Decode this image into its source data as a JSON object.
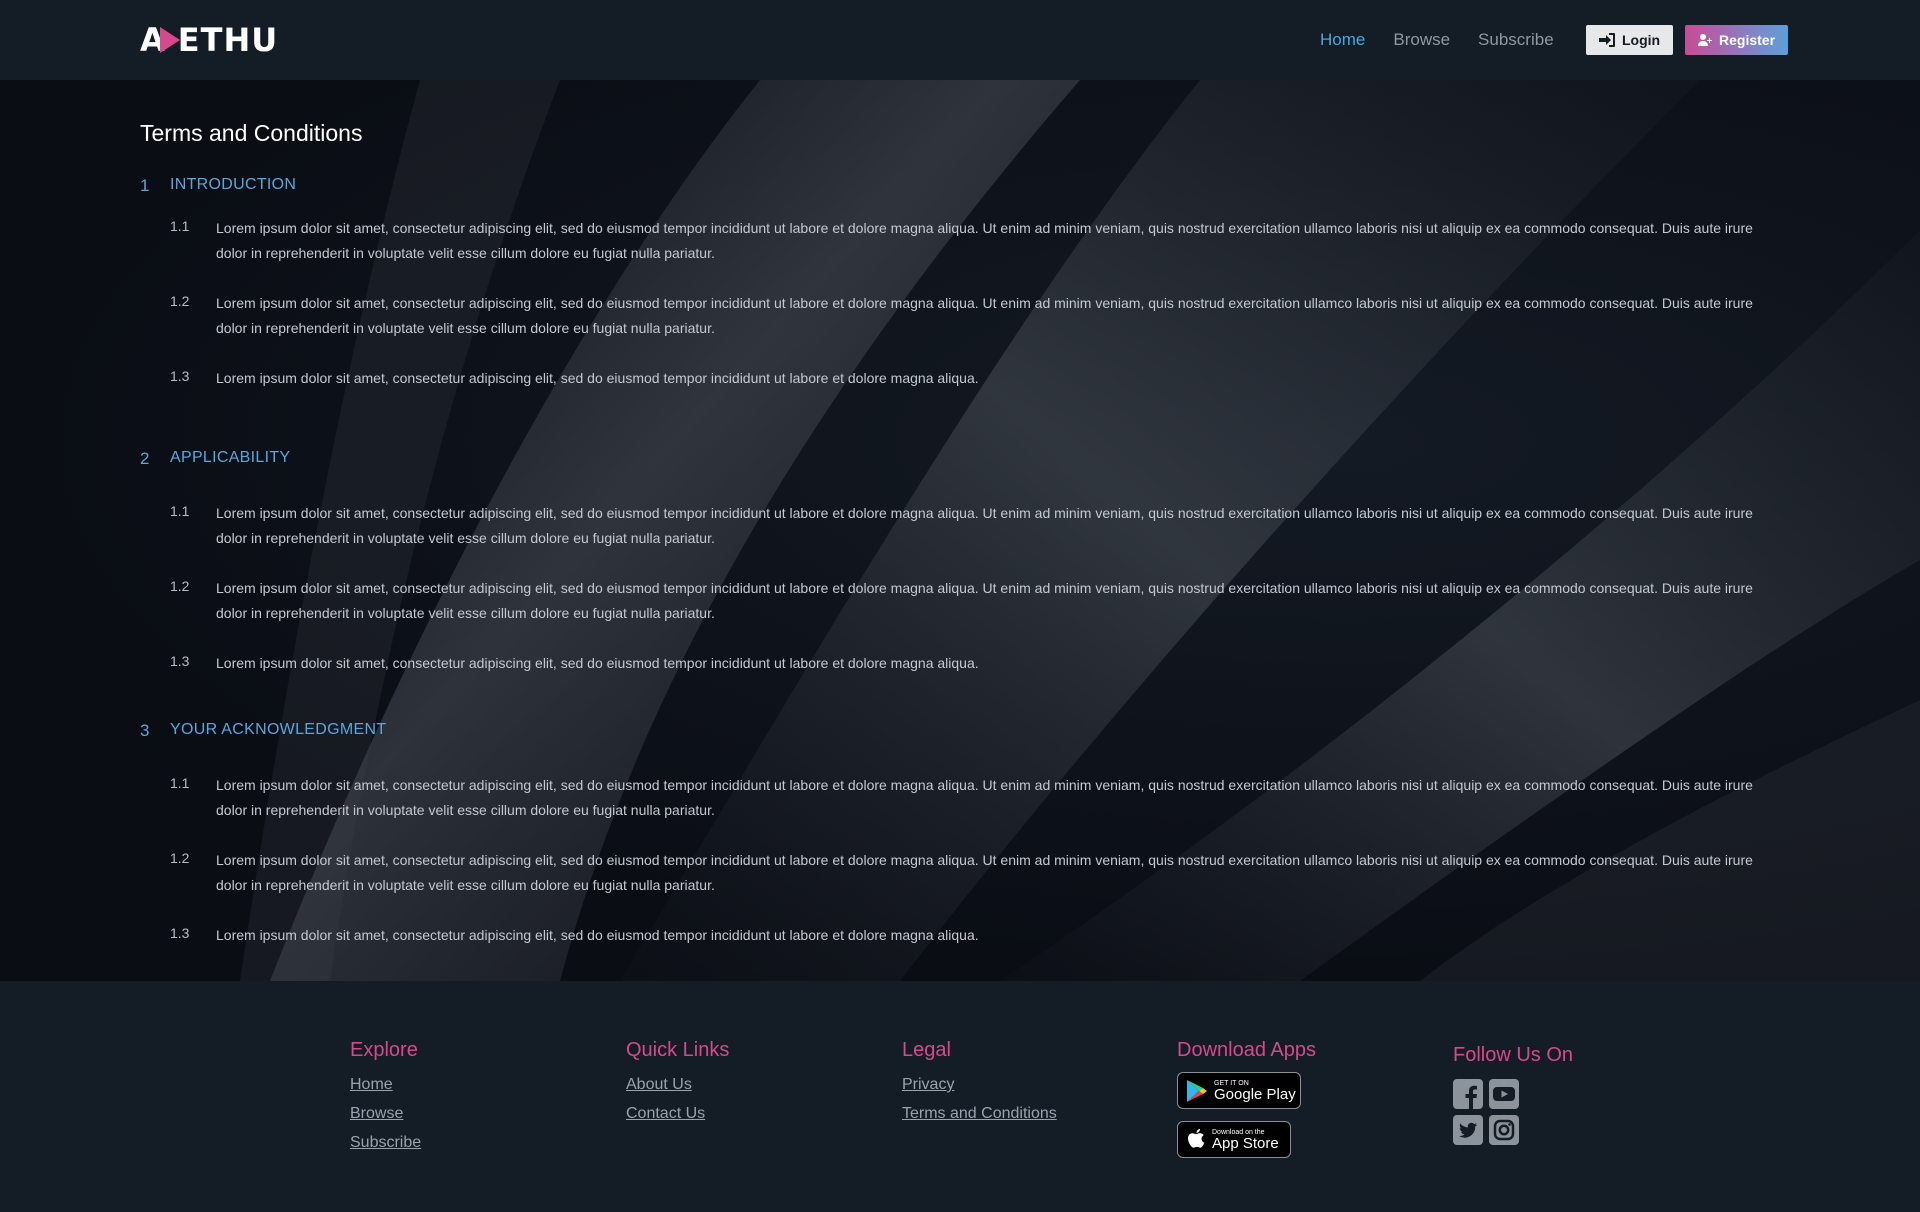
{
  "header": {
    "logo_text": "AETHU",
    "nav": [
      {
        "label": "Home",
        "active": true
      },
      {
        "label": "Browse",
        "active": false
      },
      {
        "label": "Subscribe",
        "active": false
      }
    ],
    "login_label": "Login",
    "register_label": "Register"
  },
  "page": {
    "title": "Terms and Conditions",
    "sections": [
      {
        "num": "1",
        "title": "INTRODUCTION",
        "clauses": [
          {
            "num": "1.1",
            "text": "Lorem ipsum dolor sit amet, consectetur adipiscing elit, sed do eiusmod tempor incididunt ut labore et dolore magna aliqua. Ut enim ad minim veniam, quis nostrud exercitation ullamco laboris nisi ut aliquip ex ea commodo consequat. Duis aute irure dolor in reprehenderit in voluptate velit esse cillum dolore eu fugiat nulla pariatur."
          },
          {
            "num": "1.2",
            "text": "Lorem ipsum dolor sit amet, consectetur adipiscing elit, sed do eiusmod tempor incididunt ut labore et dolore magna aliqua. Ut enim ad minim veniam, quis nostrud exercitation ullamco laboris nisi ut aliquip ex ea commodo consequat. Duis aute irure dolor in reprehenderit in voluptate velit esse cillum dolore eu fugiat nulla pariatur."
          },
          {
            "num": "1.3",
            "text": "Lorem ipsum dolor sit amet, consectetur adipiscing elit, sed do eiusmod tempor incididunt ut labore et dolore magna aliqua."
          }
        ]
      },
      {
        "num": "2",
        "title": "APPLICABILITY",
        "clauses": [
          {
            "num": "1.1",
            "text": "Lorem ipsum dolor sit amet, consectetur adipiscing elit, sed do eiusmod tempor incididunt ut labore et dolore magna aliqua. Ut enim ad minim veniam, quis nostrud exercitation ullamco laboris nisi ut aliquip ex ea commodo consequat. Duis aute irure dolor in reprehenderit in voluptate velit esse cillum dolore eu fugiat nulla pariatur."
          },
          {
            "num": "1.2",
            "text": "Lorem ipsum dolor sit amet, consectetur adipiscing elit, sed do eiusmod tempor incididunt ut labore et dolore magna aliqua. Ut enim ad minim veniam, quis nostrud exercitation ullamco laboris nisi ut aliquip ex ea commodo consequat. Duis aute irure dolor in reprehenderit in voluptate velit esse cillum dolore eu fugiat nulla pariatur."
          },
          {
            "num": "1.3",
            "text": "Lorem ipsum dolor sit amet, consectetur adipiscing elit, sed do eiusmod tempor incididunt ut labore et dolore magna aliqua."
          }
        ]
      },
      {
        "num": "3",
        "title": "YOUR ACKNOWLEDGMENT",
        "clauses": [
          {
            "num": "1.1",
            "text": "Lorem ipsum dolor sit amet, consectetur adipiscing elit, sed do eiusmod tempor incididunt ut labore et dolore magna aliqua. Ut enim ad minim veniam, quis nostrud exercitation ullamco laboris nisi ut aliquip ex ea commodo consequat. Duis aute irure dolor in reprehenderit in voluptate velit esse cillum dolore eu fugiat nulla pariatur."
          },
          {
            "num": "1.2",
            "text": "Lorem ipsum dolor sit amet, consectetur adipiscing elit, sed do eiusmod tempor incididunt ut labore et dolore magna aliqua. Ut enim ad minim veniam, quis nostrud exercitation ullamco laboris nisi ut aliquip ex ea commodo consequat. Duis aute irure dolor in reprehenderit in voluptate velit esse cillum dolore eu fugiat nulla pariatur."
          },
          {
            "num": "1.3",
            "text": "Lorem ipsum dolor sit amet, consectetur adipiscing elit, sed do eiusmod tempor incididunt ut labore et dolore magna aliqua."
          }
        ]
      }
    ]
  },
  "footer": {
    "explore": {
      "title": "Explore",
      "links": [
        "Home",
        "Browse",
        "Subscribe"
      ]
    },
    "quick_links": {
      "title": "Quick Links",
      "links": [
        "About Us",
        "Contact Us"
      ]
    },
    "legal": {
      "title": "Legal",
      "links": [
        "Privacy",
        "Terms and Conditions"
      ]
    },
    "apps": {
      "title": "Download Apps",
      "google_small": "GET IT ON",
      "google_big": "Google Play",
      "apple_small": "Download on the",
      "apple_big": "App Store"
    },
    "follow": {
      "title": "Follow Us On",
      "icons": [
        "facebook-icon",
        "youtube-icon",
        "twitter-icon",
        "instagram-icon"
      ]
    }
  },
  "colors": {
    "accent_blue": "#5aa7dc",
    "accent_pink": "#d64a8d",
    "header_bg": "#141c25"
  }
}
